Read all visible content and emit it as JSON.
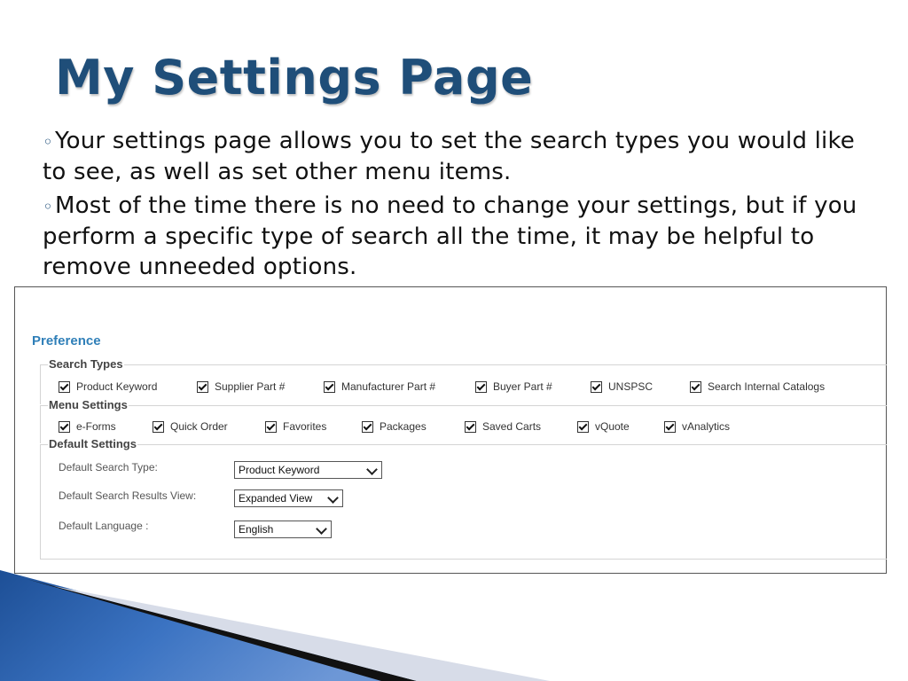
{
  "slide": {
    "title": "My Settings Page",
    "bullets": [
      "Your settings page allows you to set the search types you would like to see, as well as set other menu items.",
      "Most of the time there is no need to change your settings, but if you perform a specific type of search all the time, it may be helpful to remove unneeded options."
    ],
    "bullet_marker": "◦"
  },
  "preference": {
    "title": "Preference",
    "search_types": {
      "legend": "Search Types",
      "items": [
        "Product Keyword",
        "Supplier Part #",
        "Manufacturer Part #",
        "Buyer Part #",
        "UNSPSC",
        "Search Internal Catalogs"
      ],
      "checked": [
        true,
        true,
        true,
        true,
        true,
        true
      ]
    },
    "menu_settings": {
      "legend": "Menu Settings",
      "items": [
        "e-Forms",
        "Quick Order",
        "Favorites",
        "Packages",
        "Saved Carts",
        "vQuote",
        "vAnalytics"
      ],
      "checked": [
        true,
        true,
        true,
        true,
        true,
        true,
        true
      ]
    },
    "default_settings": {
      "legend": "Default Settings",
      "search_type_label": "Default Search Type:",
      "search_type_value": "Product Keyword",
      "results_view_label": "Default Search Results View:",
      "results_view_value": "Expanded View",
      "language_label": "Default Language :",
      "language_value": "English"
    }
  },
  "colors": {
    "title": "#1f4e79",
    "preference_title": "#2f7fb8",
    "decor_blue": "#2a5ea8"
  }
}
